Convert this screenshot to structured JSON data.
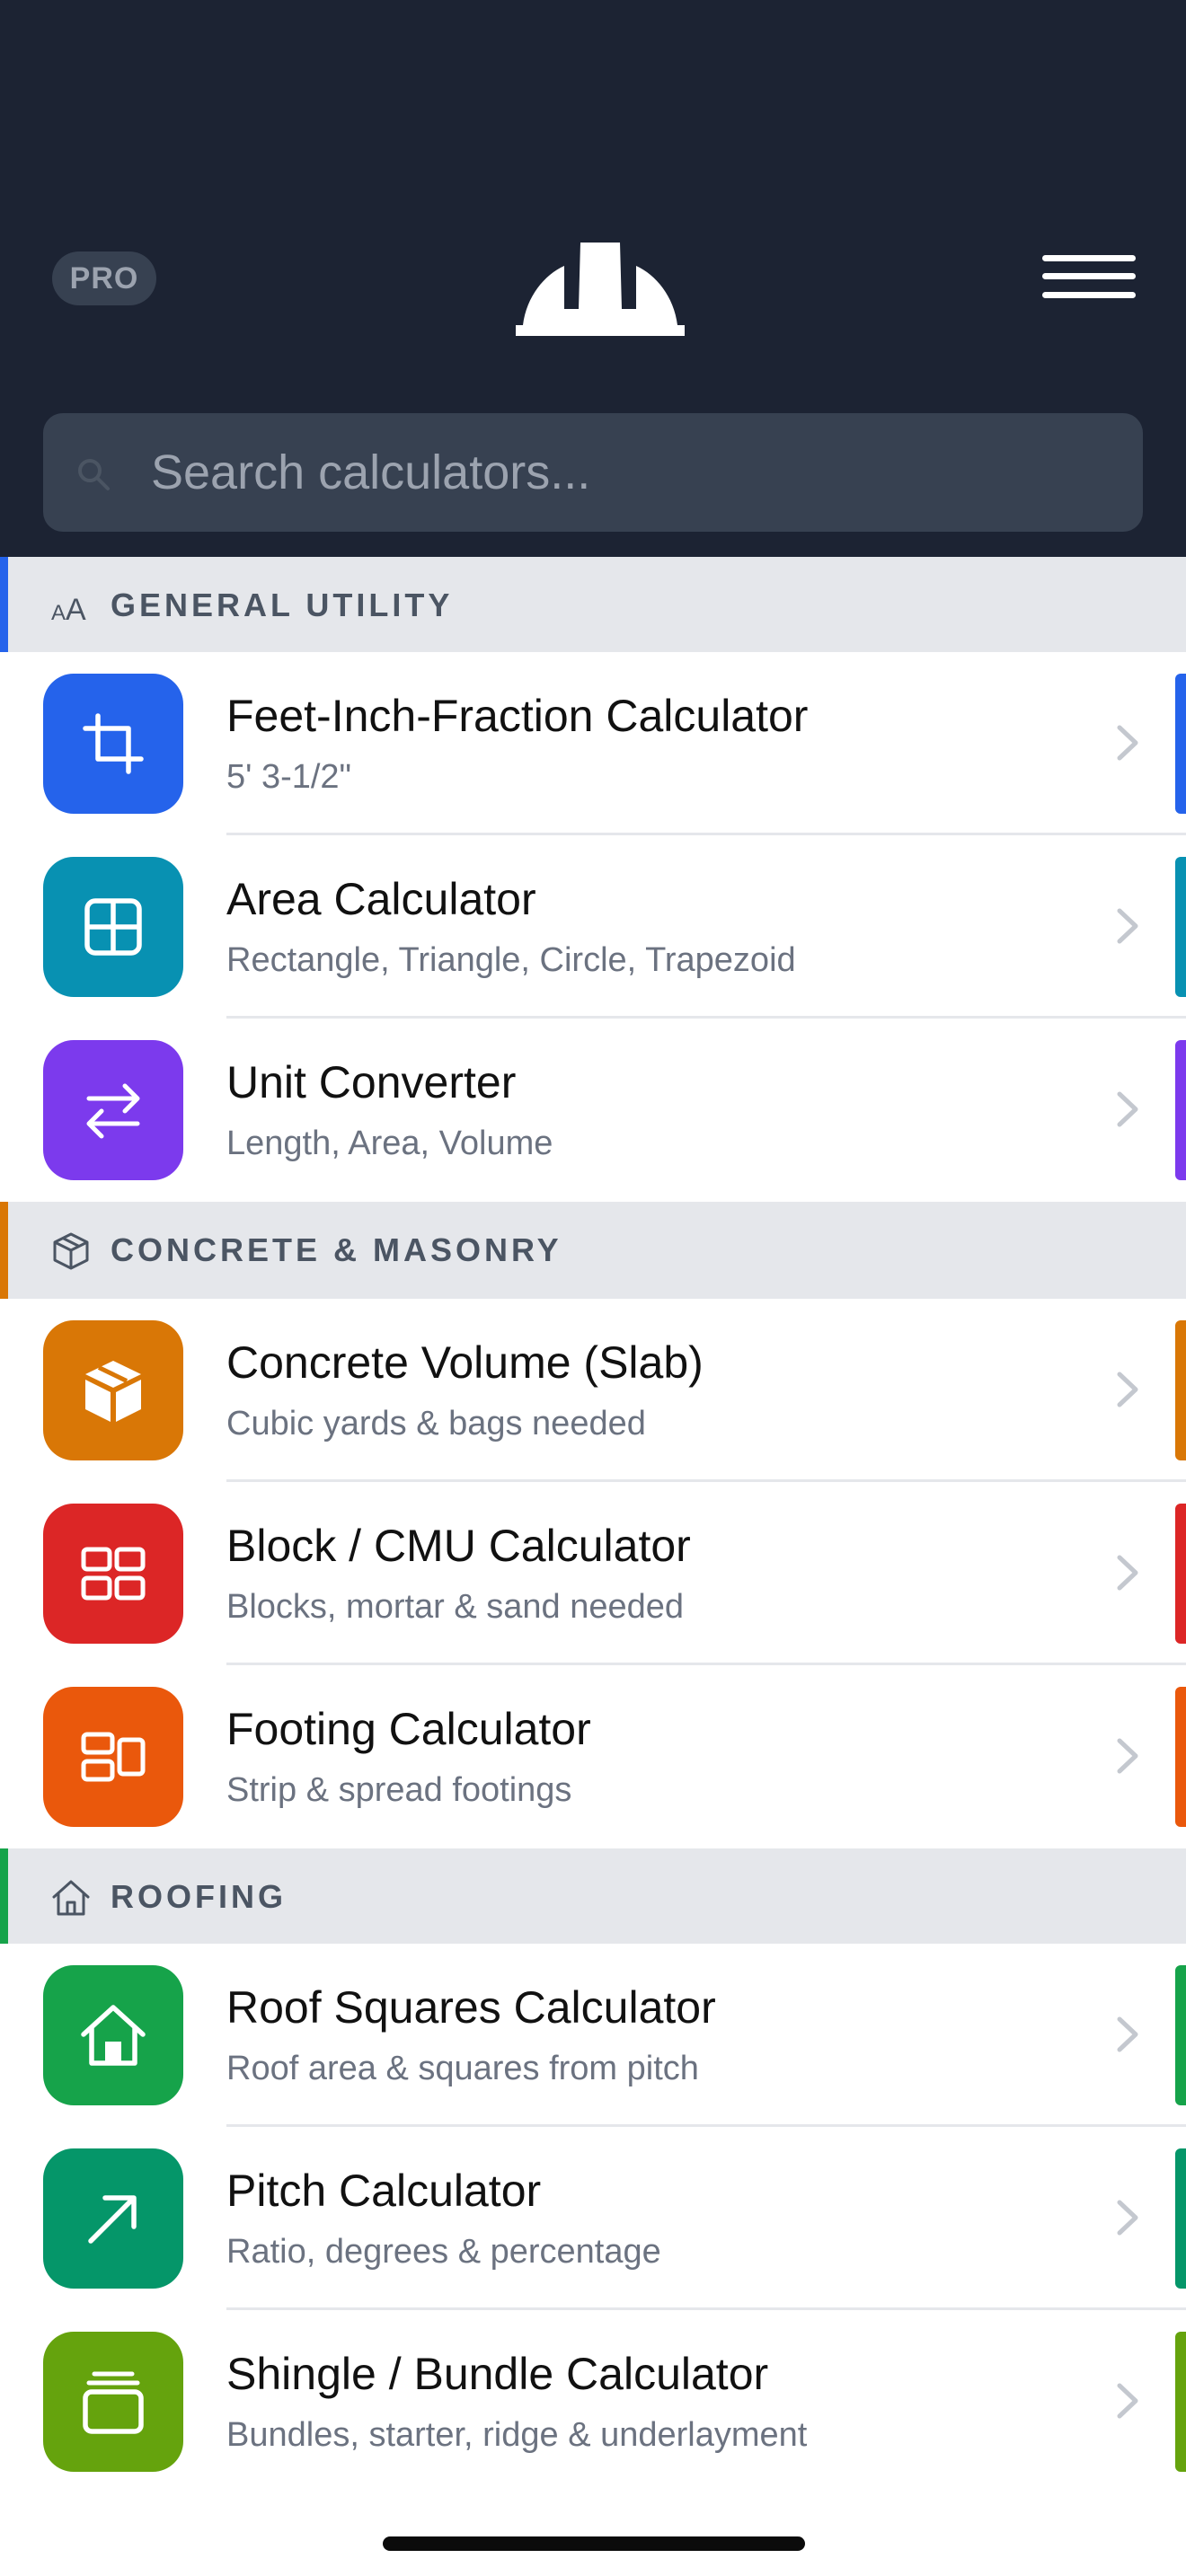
{
  "header": {
    "pro_badge": "PRO",
    "logo_icon": "hard-hat-icon",
    "menu_icon": "hamburger-menu-icon",
    "background_color": "#1c2333"
  },
  "search": {
    "placeholder": "Search calculators...",
    "value": "",
    "icon": "search-icon"
  },
  "sections": [
    {
      "title": "GENERAL UTILITY",
      "icon": "text-size-icon",
      "accent": "#2563eb",
      "items": [
        {
          "title": "Feet-Inch-Fraction Calculator",
          "subtitle": "5' 3-1/2\"",
          "icon": "crop-icon",
          "color": "#2563eb"
        },
        {
          "title": "Area Calculator",
          "subtitle": "Rectangle, Triangle, Circle, Trapezoid",
          "icon": "grid-icon",
          "color": "#0891b2"
        },
        {
          "title": "Unit Converter",
          "subtitle": "Length, Area, Volume",
          "icon": "swap-arrows-icon",
          "color": "#7c3aed"
        }
      ]
    },
    {
      "title": "CONCRETE & MASONRY",
      "icon": "box-icon",
      "accent": "#d97706",
      "items": [
        {
          "title": "Concrete Volume (Slab)",
          "subtitle": "Cubic yards & bags needed",
          "icon": "box-icon",
          "color": "#d97706"
        },
        {
          "title": "Block / CMU Calculator",
          "subtitle": "Blocks, mortar & sand needed",
          "icon": "blocks-icon",
          "color": "#dc2626"
        },
        {
          "title": "Footing Calculator",
          "subtitle": "Strip & spread footings",
          "icon": "footing-icon",
          "color": "#ea580c"
        }
      ]
    },
    {
      "title": "ROOFING",
      "icon": "house-icon",
      "accent": "#16a34a",
      "items": [
        {
          "title": "Roof Squares Calculator",
          "subtitle": "Roof area & squares from pitch",
          "icon": "house-icon",
          "color": "#16a34a"
        },
        {
          "title": "Pitch Calculator",
          "subtitle": "Ratio, degrees & percentage",
          "icon": "arrow-up-right-icon",
          "color": "#059669"
        },
        {
          "title": "Shingle / Bundle Calculator",
          "subtitle": "Bundles, starter, ridge & underlayment",
          "icon": "stack-icon",
          "color": "#65a30d"
        }
      ]
    }
  ]
}
